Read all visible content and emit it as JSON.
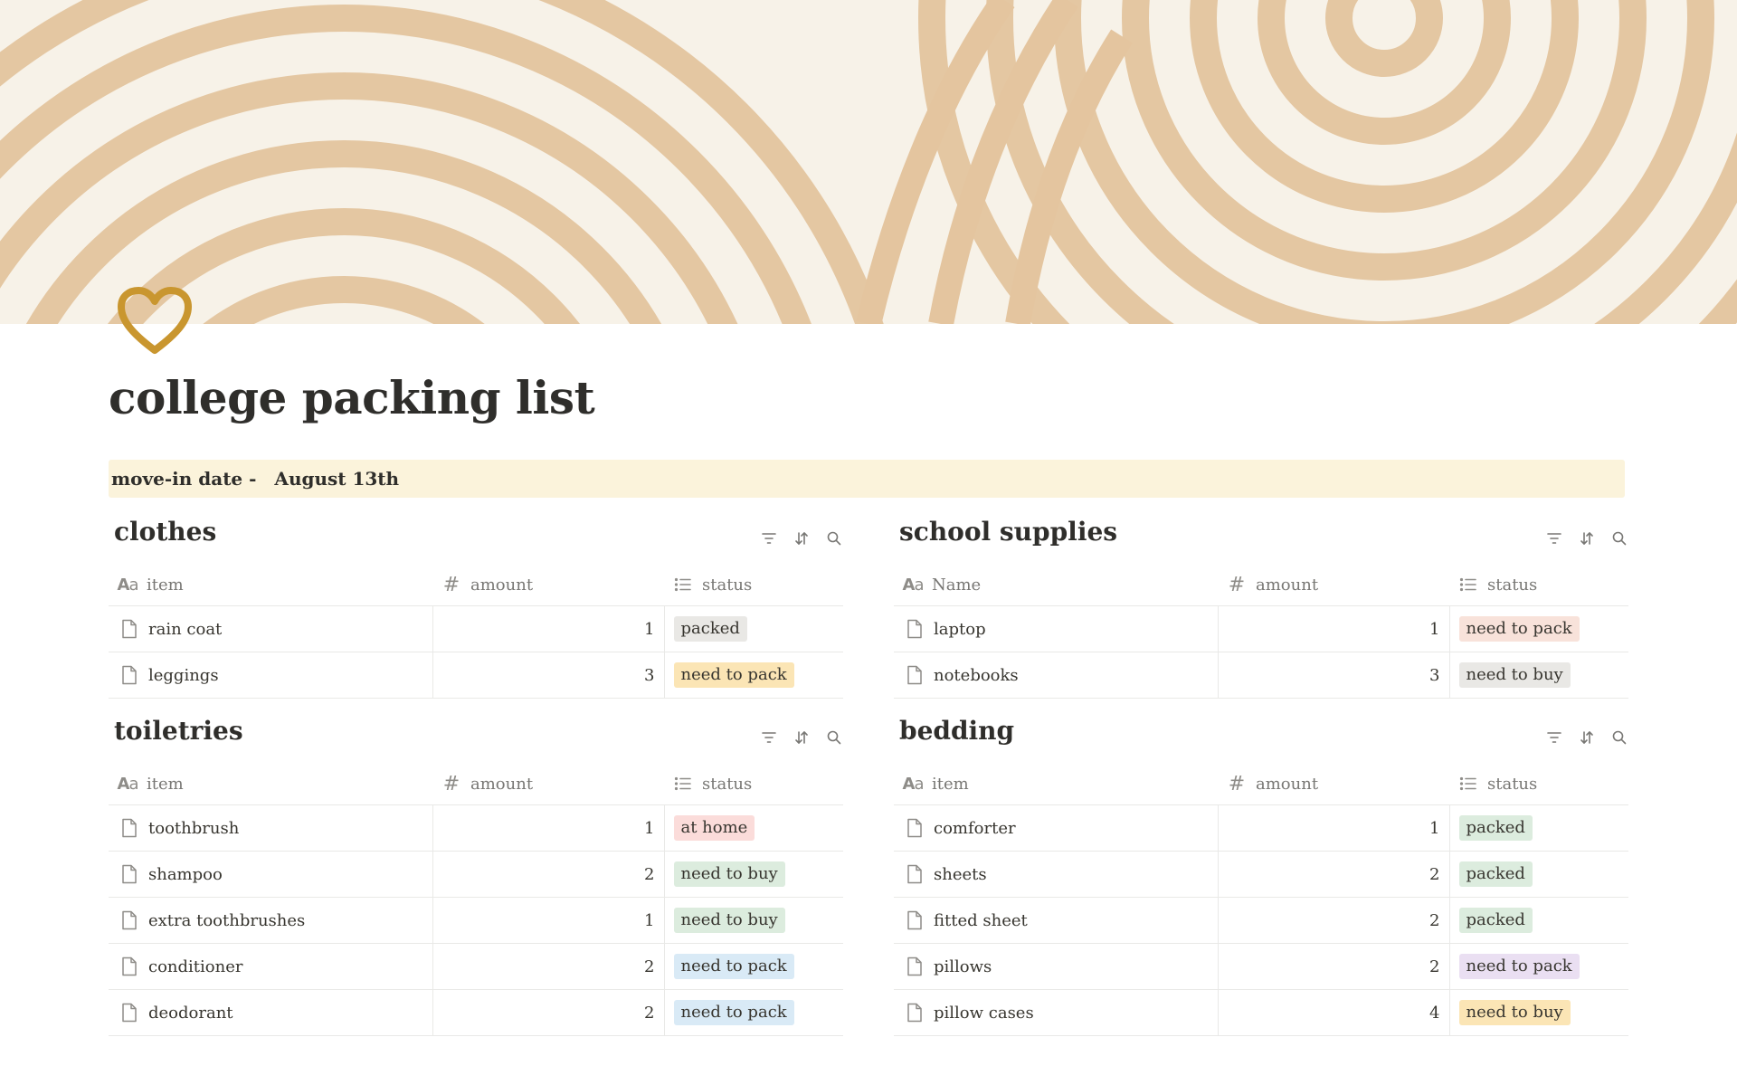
{
  "page": {
    "title": "college packing list",
    "icon": "heart-icon",
    "cover": "beige-concentric-arcs"
  },
  "callout": {
    "label": "move-in date -",
    "value": "August 13th"
  },
  "colors": {
    "callout_bg": "#fbf3db",
    "tag_gray": "#e9e8e5",
    "tag_yellow": "#fbe5b5",
    "tag_orange": "#f8e2da",
    "tag_green": "#dcecde",
    "tag_blue": "#d9eaf6",
    "tag_red": "#fbdcda",
    "tag_purple": "#eadff2",
    "cover_stripe": "#e4c59f"
  },
  "tools": {
    "filter_icon": "filter-icon",
    "sort_icon": "sort-icon",
    "search_icon": "search-icon"
  },
  "databases": {
    "clothes": {
      "title": "clothes",
      "columns": [
        "item",
        "amount",
        "status"
      ],
      "rows": [
        {
          "item": "rain coat",
          "amount": "1",
          "status": "packed",
          "tag_color": "gray"
        },
        {
          "item": "leggings",
          "amount": "3",
          "status": "need to pack",
          "tag_color": "yellow"
        }
      ]
    },
    "school_supplies": {
      "title": "school supplies",
      "columns": [
        "Name",
        "amount",
        "status"
      ],
      "rows": [
        {
          "item": "laptop",
          "amount": "1",
          "status": "need to pack",
          "tag_color": "orange"
        },
        {
          "item": "notebooks",
          "amount": "3",
          "status": "need to buy",
          "tag_color": "gray"
        }
      ]
    },
    "toiletries": {
      "title": "toiletries",
      "columns": [
        "item",
        "amount",
        "status"
      ],
      "rows": [
        {
          "item": "toothbrush",
          "amount": "1",
          "status": "at home",
          "tag_color": "red"
        },
        {
          "item": "shampoo",
          "amount": "2",
          "status": "need to buy",
          "tag_color": "green"
        },
        {
          "item": "extra toothbrushes",
          "amount": "1",
          "status": "need to buy",
          "tag_color": "green"
        },
        {
          "item": "conditioner",
          "amount": "2",
          "status": "need to pack",
          "tag_color": "blue"
        },
        {
          "item": "deodorant",
          "amount": "2",
          "status": "need to pack",
          "tag_color": "blue"
        }
      ]
    },
    "bedding": {
      "title": "bedding",
      "columns": [
        "item",
        "amount",
        "status"
      ],
      "rows": [
        {
          "item": "comforter",
          "amount": "1",
          "status": "packed",
          "tag_color": "green"
        },
        {
          "item": "sheets",
          "amount": "2",
          "status": "packed",
          "tag_color": "green"
        },
        {
          "item": "fitted sheet",
          "amount": "2",
          "status": "packed",
          "tag_color": "green"
        },
        {
          "item": "pillows",
          "amount": "2",
          "status": "need to pack",
          "tag_color": "purple"
        },
        {
          "item": "pillow cases",
          "amount": "4",
          "status": "need to buy",
          "tag_color": "yellow"
        }
      ]
    }
  }
}
